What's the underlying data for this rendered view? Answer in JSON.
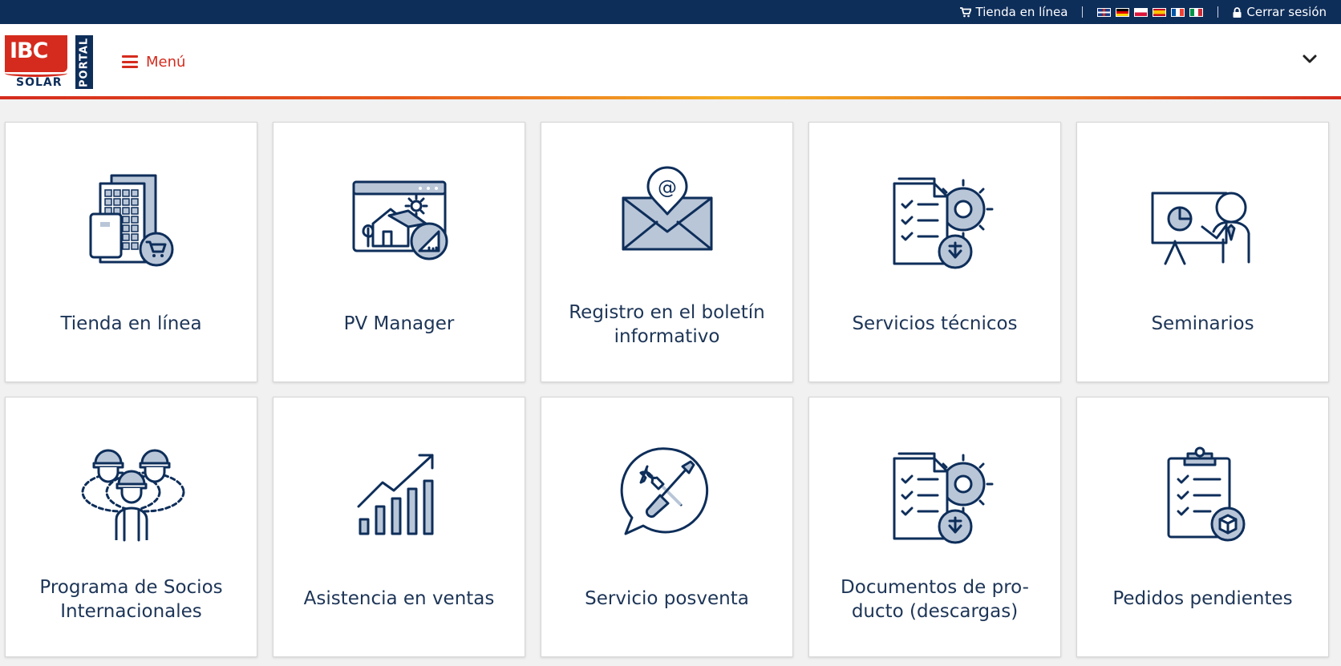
{
  "topbar": {
    "shop_label": "Tienda en línea",
    "logout_label": "Cerrar sesión",
    "languages": [
      "English",
      "Deutsch",
      "Polski",
      "Español",
      "Français",
      "Italiano"
    ]
  },
  "header": {
    "logo_text": "IBC",
    "logo_subtext": "SOLAR",
    "logo_portal": "PORTAL",
    "menu_label": "Menú"
  },
  "tiles": [
    {
      "label": "Tienda en línea",
      "icon": "online-shop-icon"
    },
    {
      "label": "PV Manager",
      "icon": "pv-manager-icon"
    },
    {
      "label": "Registro en el boletín informativo",
      "icon": "newsletter-icon"
    },
    {
      "label": "Servicios técnicos",
      "icon": "technical-services-icon"
    },
    {
      "label": "Seminarios",
      "icon": "seminar-icon"
    },
    {
      "label": "Programa de Socios Internacionales",
      "icon": "partner-program-icon"
    },
    {
      "label": "Asistencia en ventas",
      "icon": "sales-growth-icon"
    },
    {
      "label": "Servicio posventa",
      "icon": "after-sales-icon"
    },
    {
      "label": "Documentos de pro-ducto (descargas)",
      "icon": "product-documents-icon"
    },
    {
      "label": "Pedidos pendientes",
      "icon": "pending-orders-icon"
    }
  ],
  "colors": {
    "navy": "#0e2e5a",
    "red": "#d52b1e",
    "icon_fill": "#b9c6d8"
  }
}
